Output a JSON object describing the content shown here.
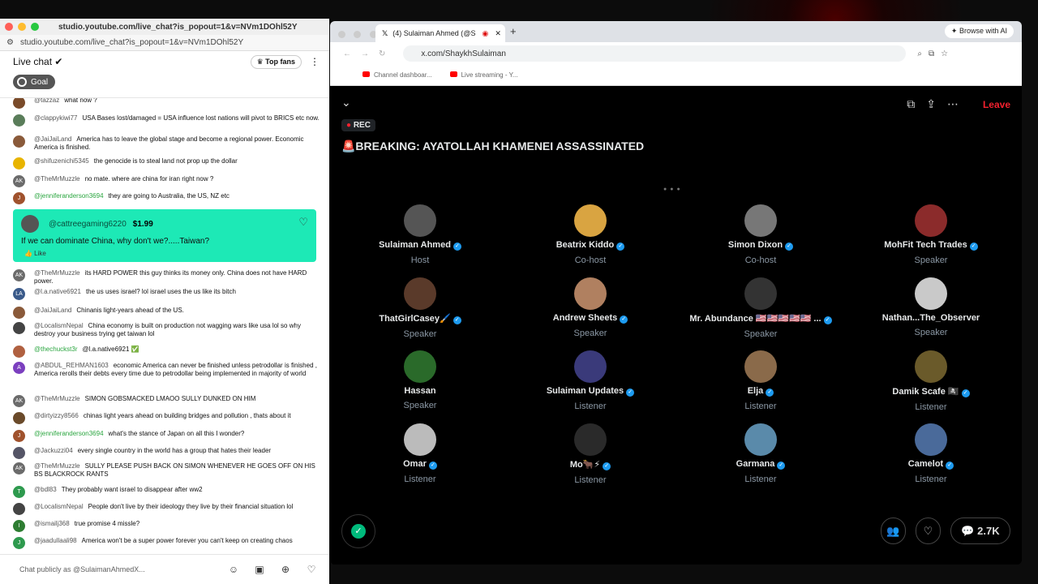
{
  "left_window": {
    "url_top": "studio.youtube.com/live_chat?is_popout=1&v=NVm1DOhl52Y",
    "url": "studio.youtube.com/live_chat?is_popout=1&v=NVm1DOhl52Y",
    "chat_title": "Live chat ✔",
    "top_fans": "Top fans",
    "goal": "Goal",
    "messages": [
      {
        "author": "@tazzaz",
        "text": "what now ?",
        "av": "",
        "color": "#7a4b2a"
      },
      {
        "author": "@clappykiwi77",
        "text": "USA Bases lost/damaged = USA influence lost nations will pivot to BRICS etc now.",
        "av": "",
        "color": "#5a7d5a"
      },
      {
        "author": "@JaiJaiLand",
        "text": "America has to leave the global stage and become a regional power. Economic America is finished.",
        "av": "",
        "color": "#8a5a3a"
      },
      {
        "author": "@shifuzenichi5345",
        "text": "the genocide is to steal land not prop up the dollar",
        "av": "",
        "color": "#e8b400"
      },
      {
        "author": "@TheMrMuzzle",
        "text": "no mate. where are china for iran right now ?",
        "av": "AK",
        "color": "#6b6b6b"
      },
      {
        "author": "@jenniferanderson3694",
        "text": "they are going to Australia, the US, NZ etc",
        "av": "J",
        "color": "#a0522d"
      },
      {
        "author": "@TheMrMuzzle",
        "text": "its HARD POWER this guy thinks its money only. China does not have HARD power.",
        "av": "AK",
        "color": "#6b6b6b"
      },
      {
        "author": "@l.a.native6921",
        "text": "the us uses israel? lol israel uses the us like its bitch",
        "av": "LA",
        "color": "#3a5a8a"
      },
      {
        "author": "@JaiJaiLand",
        "text": "Chinanis light-years ahead of the US.",
        "av": "",
        "color": "#8a5a3a"
      },
      {
        "author": "@LocalismNepal",
        "text": "China economy is built on production not wagging wars like usa lol so why destroy your business trying get taiwan lol",
        "av": "",
        "color": "#444"
      },
      {
        "author": "@thechuckst3r",
        "text": "@l.a.native6921 ✅",
        "av": "",
        "color": "#b06040"
      },
      {
        "author": "@ABDUL_REHMAN1603",
        "text": "economic America can never be finished unless petrodollar is finished , America rerolls their debts every time due to petrodollar being implemented in majority of world",
        "av": "A",
        "color": "#7b3fbf"
      },
      {
        "author": "@TheMrMuzzle",
        "text": "SIMON GOBSMACKED LMAOO SULLY DUNKED ON HIM",
        "av": "AK",
        "color": "#6b6b6b"
      },
      {
        "author": "@dirtyizzy8566",
        "text": "chinas light years ahead on building bridges and pollution , thats about it",
        "av": "",
        "color": "#6a4a2a"
      },
      {
        "author": "@jenniferanderson3694",
        "text": "what's the stance of Japan on all this I wonder?",
        "av": "J",
        "color": "#a0522d"
      },
      {
        "author": "@Jackuzzi04",
        "text": "every single country in the world has a group that hates their leader",
        "av": "",
        "color": "#556"
      },
      {
        "author": "@TheMrMuzzle",
        "text": "SULLY PLEASE PUSH BACK ON SIMON WHENEVER HE GOES OFF ON HIS BS BLACKROCK RANTS",
        "av": "AK",
        "color": "#6b6b6b"
      },
      {
        "author": "@bdl83",
        "text": "They probably want israel to disappear after ww2",
        "av": "T",
        "color": "#2e9a4e"
      },
      {
        "author": "@LocalismNepal",
        "text": "People don't live by their ideology they live by their financial situation lol",
        "av": "",
        "color": "#444"
      },
      {
        "author": "@ismailj368",
        "text": "true promise 4 missle?",
        "av": "I",
        "color": "#2e7d32"
      },
      {
        "author": "@jaadullaali98",
        "text": "America won't be a super power forever you can't keep on creating chaos",
        "av": "J",
        "color": "#2e9a4e"
      }
    ],
    "superchat": {
      "author": "@cattreegaming6220",
      "amount": "$1.99",
      "text": "If we can dominate China, why don't we?.....Taiwan?",
      "like": "Like"
    },
    "input_placeholder": "Chat publicly as @SulaimanAhmedX..."
  },
  "right_window": {
    "tab_title": "(4) Sulaiman Ahmed (@S",
    "browse_ai": "Browse with AI",
    "url": "x.com/ShaykhSulaiman",
    "bookmarks": [
      "Channel dashboar...",
      "Live streaming - Y..."
    ],
    "rec": "REC",
    "title": "🚨BREAKING: AYATOLLAH KHAMENEI ASSASSINATED",
    "leave": "Leave",
    "count": "2.7K",
    "participants": [
      {
        "name": "Sulaiman Ahmed",
        "role": "Host",
        "verified": true,
        "color": "#555"
      },
      {
        "name": "Beatrix Kiddo",
        "role": "Co-host",
        "verified": true,
        "color": "#d9a441"
      },
      {
        "name": "Simon Dixon",
        "role": "Co-host",
        "verified": true,
        "color": "#777"
      },
      {
        "name": "MohFit Tech Trades",
        "role": "Speaker",
        "verified": true,
        "color": "#8b2b2b"
      },
      {
        "name": "ThatGirlCasey🖌️",
        "role": "Speaker",
        "verified": true,
        "color": "#5a3a2a"
      },
      {
        "name": "Andrew Sheets",
        "role": "Speaker",
        "verified": true,
        "color": "#b08060"
      },
      {
        "name": "Mr. Abundance 🇺🇸🇺🇸🇺🇸🇺🇸🇺🇸 ...",
        "role": "Speaker",
        "verified": true,
        "color": "#333"
      },
      {
        "name": "Nathan...The_Observer",
        "role": "Speaker",
        "verified": false,
        "color": "#c9c9c9"
      },
      {
        "name": "Hassan",
        "role": "Speaker",
        "verified": false,
        "color": "#2a6a2a"
      },
      {
        "name": "Sulaiman Updates",
        "role": "Listener",
        "verified": true,
        "color": "#3a3a7a"
      },
      {
        "name": "Elja",
        "role": "Listener",
        "verified": true,
        "color": "#8a6a4a"
      },
      {
        "name": "Damik Scafe 🏴‍☠️",
        "role": "Listener",
        "verified": true,
        "color": "#6a5a2a"
      },
      {
        "name": "Omar",
        "role": "Listener",
        "verified": true,
        "color": "#bbb"
      },
      {
        "name": "Mo🐂⚡",
        "role": "Listener",
        "verified": true,
        "color": "#2a2a2a"
      },
      {
        "name": "Garmana",
        "role": "Listener",
        "verified": true,
        "color": "#5a8aaa"
      },
      {
        "name": "Camelot",
        "role": "Listener",
        "verified": true,
        "color": "#4a6a9a"
      }
    ]
  }
}
